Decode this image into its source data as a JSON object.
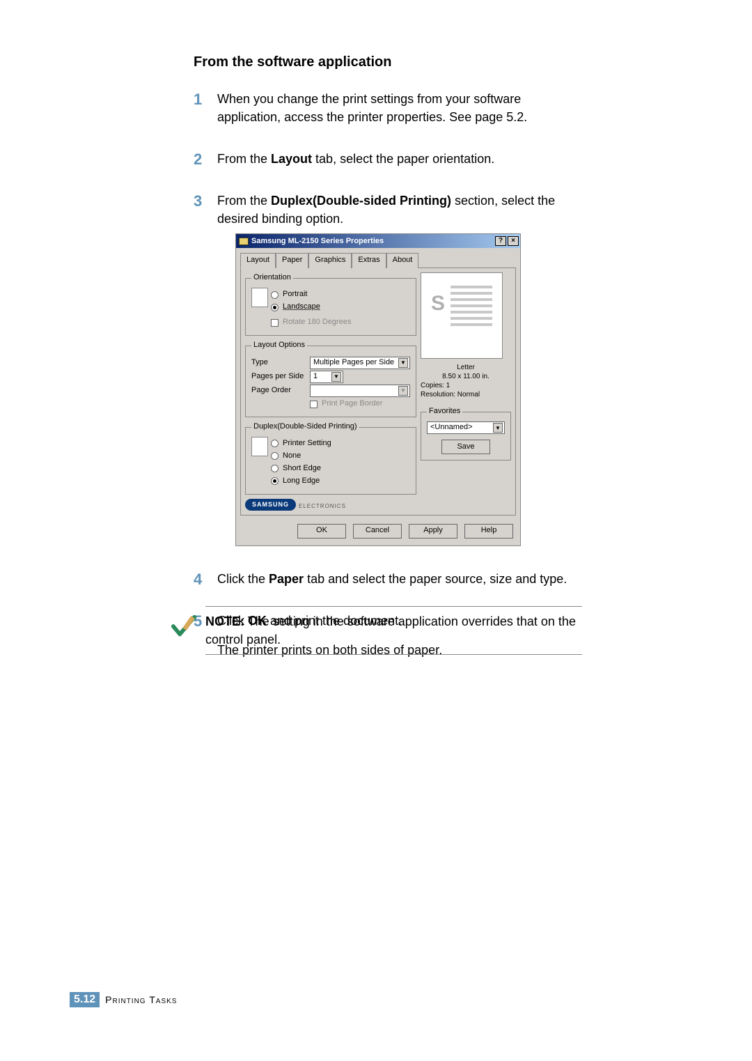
{
  "heading": "From the software application",
  "steps": {
    "s1": {
      "num": "1",
      "text_a": "When you change the print settings from your software application, access the printer properties. See page 5.2."
    },
    "s2": {
      "num": "2",
      "pre": "From the ",
      "bold": "Layout",
      "post": " tab, select the paper orientation."
    },
    "s3": {
      "num": "3",
      "pre": "From the ",
      "bold": "Duplex(Double-sided Printing)",
      "post": " section, select the desired binding option."
    },
    "s4": {
      "num": "4",
      "pre": "Click the ",
      "bold": "Paper",
      "post": " tab and select the paper source, size and type."
    },
    "s5": {
      "num": "5",
      "pre": "Click ",
      "bold": "OK",
      "post": " and print the document."
    }
  },
  "both_sides": "The printer prints on both sides of paper.",
  "note": {
    "label": "NOTE:",
    "text": " The setting in the software application overrides that on the control panel."
  },
  "dialog": {
    "title": "Samsung ML-2150 Series Properties",
    "tabs": [
      "Layout",
      "Paper",
      "Graphics",
      "Extras",
      "About"
    ],
    "orientation": {
      "legend": "Orientation",
      "portrait": "Portrait",
      "landscape": "Landscape",
      "rotate": "Rotate 180 Degrees"
    },
    "layout_options": {
      "legend": "Layout Options",
      "type_label": "Type",
      "type_value": "Multiple Pages per Side",
      "pps_label": "Pages per Side",
      "pps_value": "1",
      "order_label": "Page Order",
      "border": "Print Page Border"
    },
    "duplex": {
      "legend": "Duplex(Double-Sided Printing)",
      "opts": [
        "Printer Setting",
        "None",
        "Short Edge",
        "Long Edge"
      ]
    },
    "preview": {
      "paper": "Letter",
      "size": "8.50 x 11.00 in.",
      "copies": "Copies: 1",
      "resolution": "Resolution: Normal"
    },
    "favorites": {
      "legend": "Favorites",
      "value": "<Unnamed>",
      "save": "Save"
    },
    "brand": {
      "name": "SAMSUNG",
      "sub": "ELECTRONICS"
    },
    "buttons": {
      "ok": "OK",
      "cancel": "Cancel",
      "apply": "Apply",
      "help": "Help"
    }
  },
  "footer": {
    "chapter": "5.",
    "page": "12",
    "section": "Printing Tasks"
  }
}
